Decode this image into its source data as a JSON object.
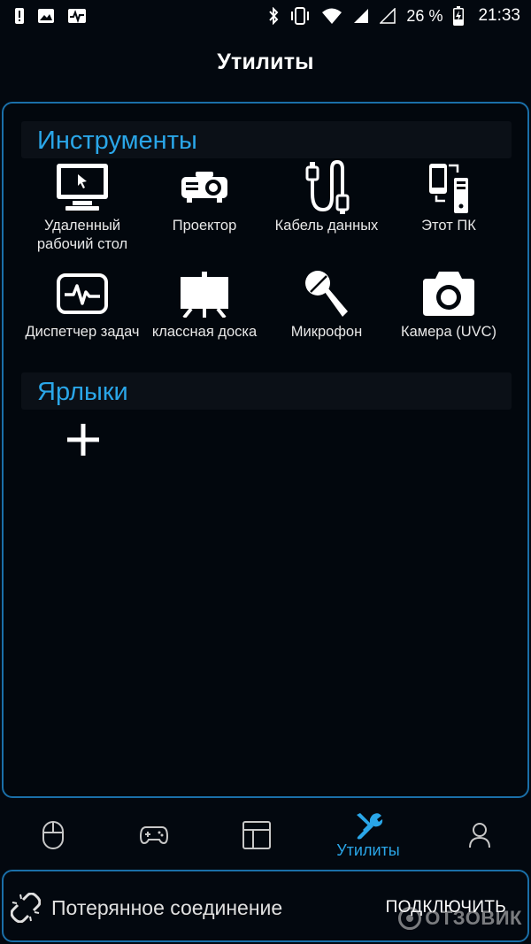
{
  "status_bar": {
    "battery_percent": "26 %",
    "time": "21:33",
    "icons": [
      "alert-icon",
      "image-icon",
      "activity-icon",
      "bluetooth-icon",
      "vibrate-icon",
      "wifi-icon",
      "signal-icon",
      "signal-empty-icon",
      "battery-charging-icon"
    ]
  },
  "header": {
    "title": "Утилиты"
  },
  "tools": {
    "title": "Инструменты",
    "items": [
      {
        "label": "Удаленный рабочий стол",
        "icon": "monitor-cursor-icon"
      },
      {
        "label": "Проектор",
        "icon": "projector-icon"
      },
      {
        "label": "Кабель данных",
        "icon": "usb-cable-icon"
      },
      {
        "label": "Этот ПК",
        "icon": "phone-pc-icon"
      },
      {
        "label": "Диспетчер задач",
        "icon": "task-monitor-icon"
      },
      {
        "label": "классная доска",
        "icon": "whiteboard-icon"
      },
      {
        "label": "Микрофон",
        "icon": "microphone-icon"
      },
      {
        "label": "Камера (UVC)",
        "icon": "camera-icon"
      }
    ]
  },
  "shortcuts": {
    "title": "Ярлыки",
    "add_icon": "plus-icon"
  },
  "bottom_nav": {
    "items": [
      {
        "name": "mouse",
        "icon": "mouse-icon",
        "label": ""
      },
      {
        "name": "gamepad",
        "icon": "gamepad-icon",
        "label": ""
      },
      {
        "name": "layout",
        "icon": "layout-icon",
        "label": ""
      },
      {
        "name": "utilities",
        "icon": "wrench-icon",
        "label": "Утилиты",
        "active": true
      },
      {
        "name": "profile",
        "icon": "user-icon",
        "label": ""
      }
    ]
  },
  "connection": {
    "status": "Потерянное соединение",
    "button": "ПОДКЛЮЧИТЬ",
    "icon": "broken-link-icon"
  },
  "watermark": {
    "text": "ОТЗОВИК"
  },
  "colors": {
    "accent": "#2aa6e8",
    "border": "#1a6fa8",
    "background": "#03080f"
  }
}
